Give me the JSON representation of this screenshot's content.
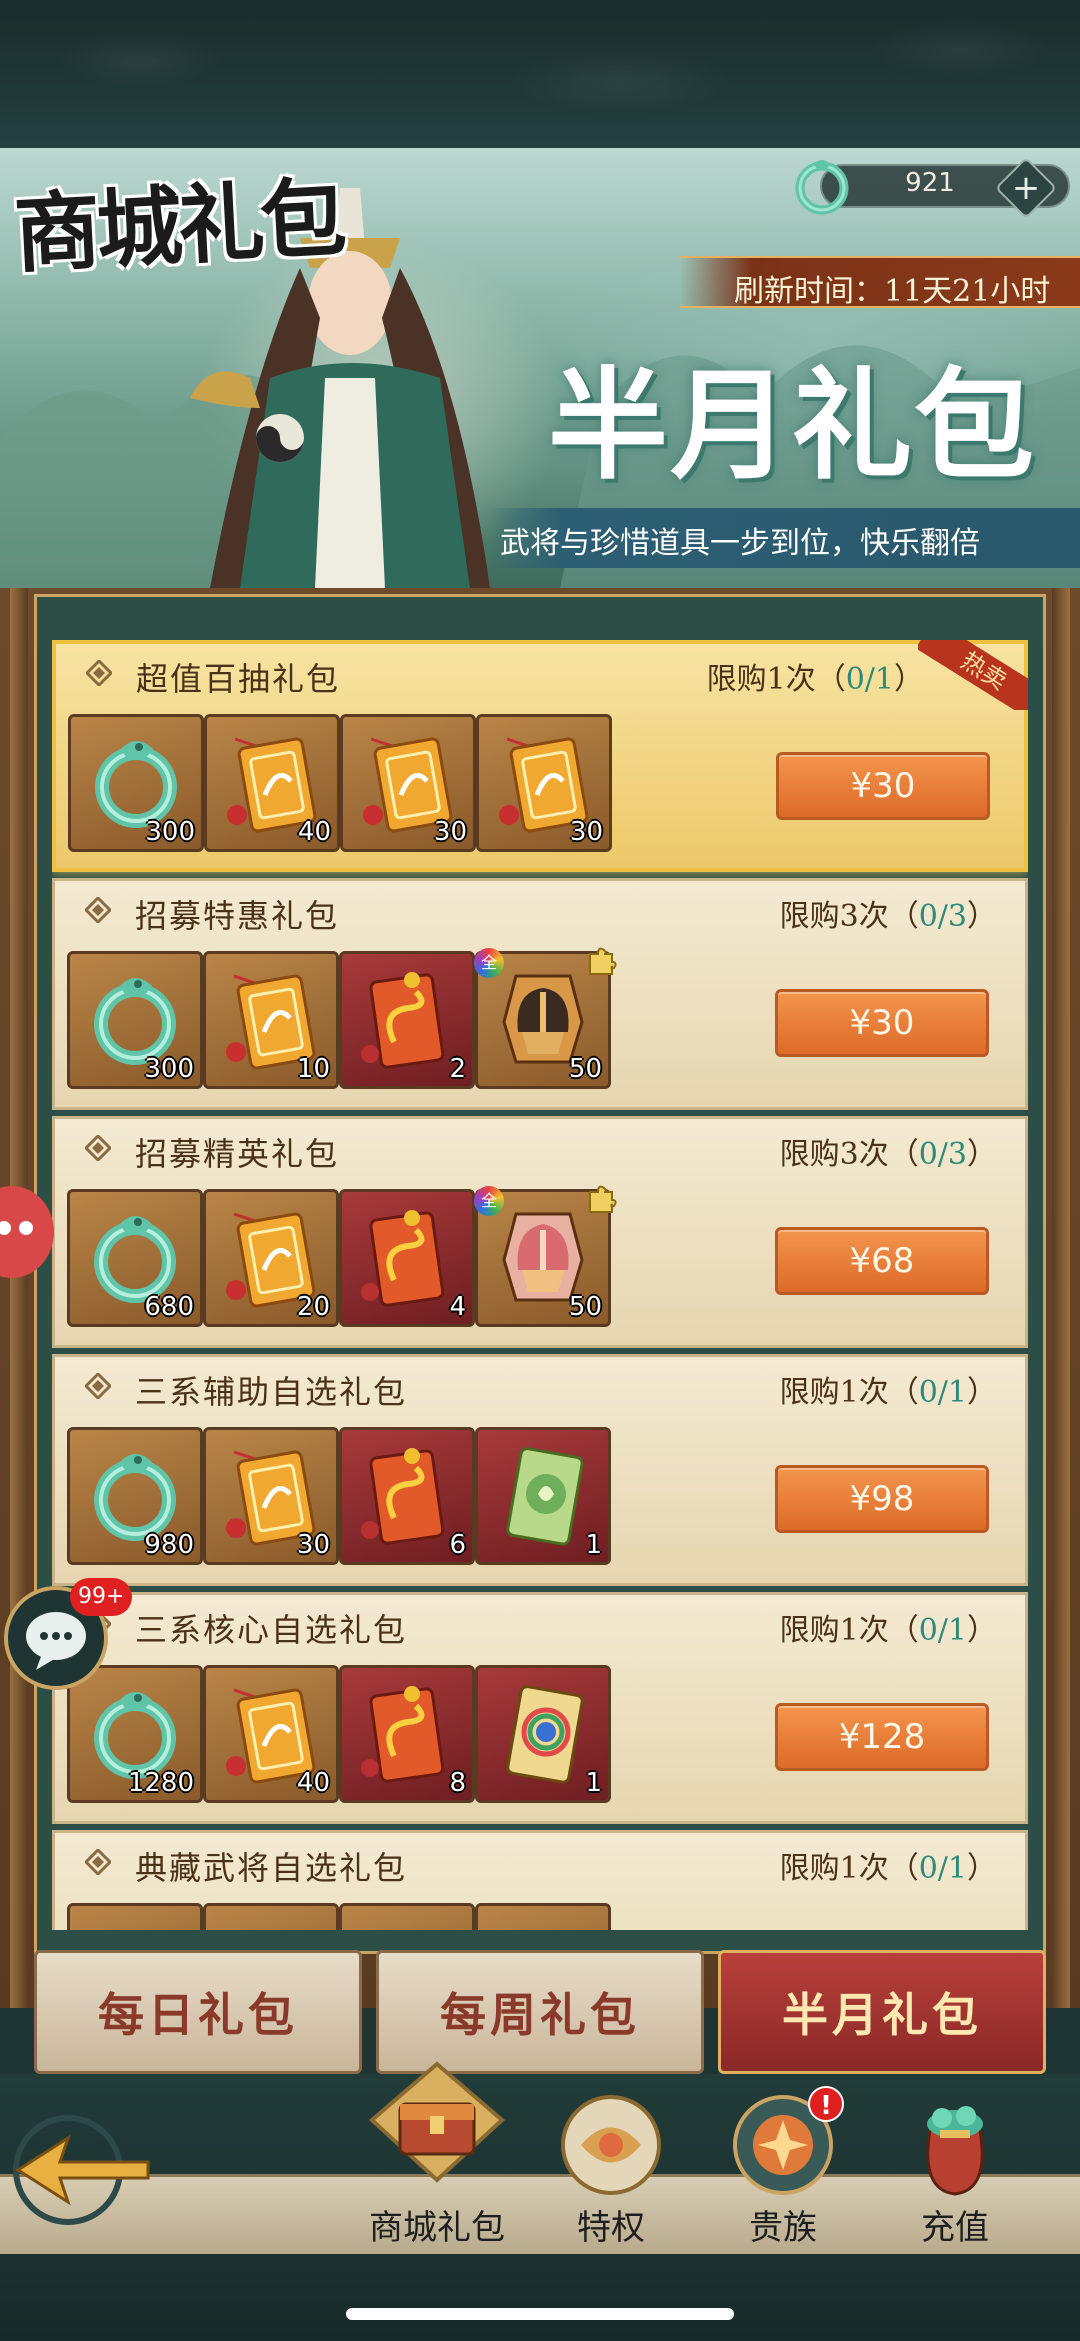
{
  "header": {
    "title": "商城礼包",
    "currency_value": "921",
    "plus_label": "+",
    "refresh_text": "刷新时间：11天21小时",
    "banner_title": "半月礼包",
    "slogan": "武将与珍惜道具一步到位，快乐翻倍"
  },
  "packs": [
    {
      "name": "超值百抽礼包",
      "limit_prefix": "限购1次（",
      "limit_count": "0/1",
      "limit_suffix": "）",
      "hot": "热卖",
      "price": "¥30",
      "items": [
        {
          "icon": "jade-dragon-icon",
          "qty": "300"
        },
        {
          "icon": "gold-recruit-token-icon",
          "qty": "40"
        },
        {
          "icon": "gold-recruit-token-icon",
          "qty": "30"
        },
        {
          "icon": "gold-recruit-token-icon",
          "qty": "30"
        }
      ]
    },
    {
      "name": "招募特惠礼包",
      "limit_prefix": "限购3次（",
      "limit_count": "0/3",
      "limit_suffix": "）",
      "price": "¥30",
      "items": [
        {
          "icon": "jade-dragon-icon",
          "qty": "300"
        },
        {
          "icon": "gold-recruit-token-icon",
          "qty": "10"
        },
        {
          "icon": "red-dragon-token-icon",
          "qty": "2"
        },
        {
          "icon": "helmet-shard-icon",
          "qty": "50",
          "badge": "全"
        }
      ]
    },
    {
      "name": "招募精英礼包",
      "limit_prefix": "限购3次（",
      "limit_count": "0/3",
      "limit_suffix": "）",
      "price": "¥68",
      "items": [
        {
          "icon": "jade-dragon-icon",
          "qty": "680"
        },
        {
          "icon": "gold-recruit-token-icon",
          "qty": "20"
        },
        {
          "icon": "red-dragon-token-icon",
          "qty": "4"
        },
        {
          "icon": "pink-helmet-shard-icon",
          "qty": "50",
          "badge": "全"
        }
      ]
    },
    {
      "name": "三系辅助自选礼包",
      "limit_prefix": "限购1次（",
      "limit_count": "0/1",
      "limit_suffix": "）",
      "price": "¥98",
      "items": [
        {
          "icon": "jade-dragon-icon",
          "qty": "980"
        },
        {
          "icon": "gold-recruit-token-icon",
          "qty": "30"
        },
        {
          "icon": "red-dragon-token-icon",
          "qty": "6"
        },
        {
          "icon": "green-select-card-icon",
          "qty": "1"
        }
      ]
    },
    {
      "name": "三系核心自选礼包",
      "limit_prefix": "限购1次（",
      "limit_count": "0/1",
      "limit_suffix": "）",
      "price": "¥128",
      "items": [
        {
          "icon": "jade-dragon-icon",
          "qty": "1280"
        },
        {
          "icon": "gold-recruit-token-icon",
          "qty": "40"
        },
        {
          "icon": "red-dragon-token-icon",
          "qty": "8"
        },
        {
          "icon": "rainbow-select-card-icon",
          "qty": "1"
        }
      ]
    },
    {
      "name": "典藏武将自选礼包",
      "limit_prefix": "限购1次（",
      "limit_count": "0/1",
      "limit_suffix": "）",
      "price": "",
      "items": [
        {
          "icon": "item-icon",
          "qty": ""
        },
        {
          "icon": "item-icon",
          "qty": ""
        },
        {
          "icon": "item-icon",
          "qty": ""
        },
        {
          "icon": "item-icon",
          "qty": ""
        }
      ]
    }
  ],
  "tabs": [
    {
      "label": "每日礼包",
      "active": false
    },
    {
      "label": "每周礼包",
      "active": false
    },
    {
      "label": "半月礼包",
      "active": true
    }
  ],
  "nav": [
    {
      "label": "商城礼包",
      "icon": "treasure-chest-icon",
      "active": true
    },
    {
      "label": "特权",
      "icon": "privilege-icon"
    },
    {
      "label": "贵族",
      "icon": "noble-icon",
      "alert": "!"
    },
    {
      "label": "充值",
      "icon": "money-bag-icon"
    }
  ],
  "chat": {
    "badge": "99+"
  },
  "colors": {
    "accent_orange": "#dd6a28",
    "active_tab": "#8a2828",
    "count_teal": "#2e8a7a"
  }
}
